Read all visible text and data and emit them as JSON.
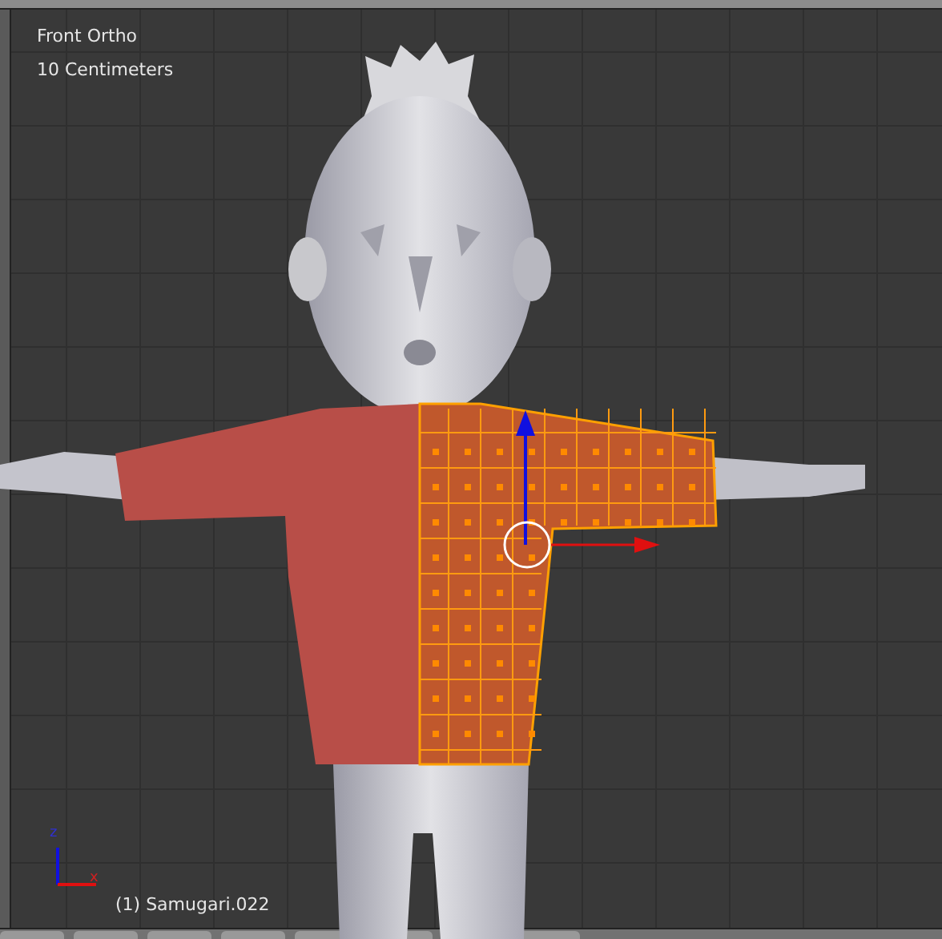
{
  "viewport": {
    "view_name": "Front Ortho",
    "scale": "10 Centimeters",
    "object_label": "(1) Samugari.022"
  },
  "axes": {
    "vertical": "z",
    "horizontal": "x"
  }
}
